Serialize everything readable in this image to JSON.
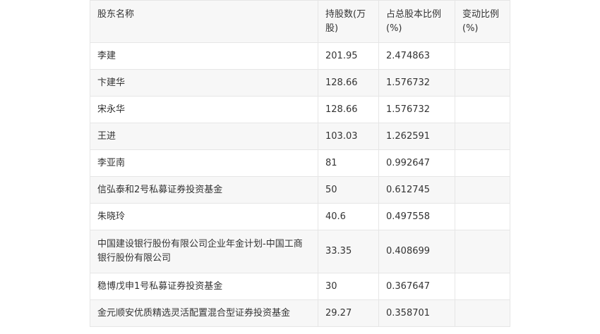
{
  "table": {
    "headers": [
      "股东名称",
      "持股数(万股)",
      "占总股本比例(%)",
      "变动比例(%)"
    ],
    "rows": [
      {
        "name": "李建",
        "shares": "201.95",
        "ratio": "2.474863",
        "change": ""
      },
      {
        "name": "卞建华",
        "shares": "128.66",
        "ratio": "1.576732",
        "change": ""
      },
      {
        "name": "宋永华",
        "shares": "128.66",
        "ratio": "1.576732",
        "change": ""
      },
      {
        "name": "王进",
        "shares": "103.03",
        "ratio": "1.262591",
        "change": ""
      },
      {
        "name": "李亚南",
        "shares": "81",
        "ratio": "0.992647",
        "change": ""
      },
      {
        "name": "信弘泰和2号私募证券投资基金",
        "shares": "50",
        "ratio": "0.612745",
        "change": ""
      },
      {
        "name": "朱晓玲",
        "shares": "40.6",
        "ratio": "0.497558",
        "change": ""
      },
      {
        "name": "中国建设银行股份有限公司企业年金计划-中国工商银行股份有限公司",
        "shares": "33.35",
        "ratio": "0.408699",
        "change": ""
      },
      {
        "name": "稳博戊申1号私募证券投资基金",
        "shares": "30",
        "ratio": "0.367647",
        "change": ""
      },
      {
        "name": "金元顺安优质精选灵活配置混合型证券投资基金",
        "shares": "29.27",
        "ratio": "0.358701",
        "change": ""
      }
    ]
  }
}
